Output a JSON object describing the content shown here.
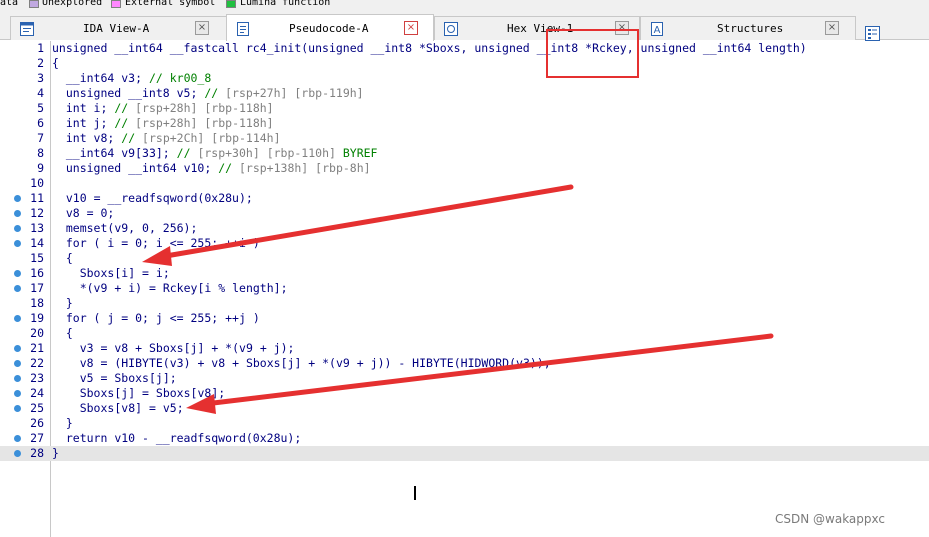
{
  "legend": [
    {
      "label": "ata",
      "swatch": "#c8b878"
    },
    {
      "label": "Unexplored",
      "swatch": "#c0a8e0"
    },
    {
      "label": "External symbol",
      "swatch": "#ff88ff"
    },
    {
      "label": "Lumina function",
      "swatch": "#20c040"
    }
  ],
  "tabs": [
    {
      "label": "IDA View-A",
      "icon": "ida-view-icon",
      "active": false
    },
    {
      "label": "Pseudocode-A",
      "icon": "pseudocode-icon",
      "active": true
    },
    {
      "label": "Hex View-1",
      "icon": "hex-view-icon",
      "active": false
    },
    {
      "label": "Structures",
      "icon": "structures-icon",
      "active": false
    }
  ],
  "close_glyph": "×",
  "code": [
    {
      "n": "1",
      "dot": false,
      "t": "unsigned __int64 __fastcall rc4_init(unsigned __int8 *Sboxs, unsigned __int8 *Rckey, unsigned __int64 length)"
    },
    {
      "n": "2",
      "dot": false,
      "t": "{"
    },
    {
      "n": "3",
      "dot": false,
      "t": "  __int64 v3; // kr00_8"
    },
    {
      "n": "4",
      "dot": false,
      "t": "  unsigned __int8 v5; // [rsp+27h] [rbp-119h]"
    },
    {
      "n": "5",
      "dot": false,
      "t": "  int i; // [rsp+28h] [rbp-118h]"
    },
    {
      "n": "6",
      "dot": false,
      "t": "  int j; // [rsp+28h] [rbp-118h]"
    },
    {
      "n": "7",
      "dot": false,
      "t": "  int v8; // [rsp+2Ch] [rbp-114h]"
    },
    {
      "n": "8",
      "dot": false,
      "t": "  __int64 v9[33]; // [rsp+30h] [rbp-110h] BYREF"
    },
    {
      "n": "9",
      "dot": false,
      "t": "  unsigned __int64 v10; // [rsp+138h] [rbp-8h]"
    },
    {
      "n": "10",
      "dot": false,
      "t": ""
    },
    {
      "n": "11",
      "dot": true,
      "t": "  v10 = __readfsqword(0x28u);"
    },
    {
      "n": "12",
      "dot": true,
      "t": "  v8 = 0;"
    },
    {
      "n": "13",
      "dot": true,
      "t": "  memset(v9, 0, 256);"
    },
    {
      "n": "14",
      "dot": true,
      "t": "  for ( i = 0; i <= 255; ++i )"
    },
    {
      "n": "15",
      "dot": false,
      "t": "  {"
    },
    {
      "n": "16",
      "dot": true,
      "t": "    Sboxs[i] = i;"
    },
    {
      "n": "17",
      "dot": true,
      "t": "    *(v9 + i) = Rckey[i % length];"
    },
    {
      "n": "18",
      "dot": false,
      "t": "  }"
    },
    {
      "n": "19",
      "dot": true,
      "t": "  for ( j = 0; j <= 255; ++j )"
    },
    {
      "n": "20",
      "dot": false,
      "t": "  {"
    },
    {
      "n": "21",
      "dot": true,
      "t": "    v3 = v8 + Sboxs[j] + *(v9 + j);"
    },
    {
      "n": "22",
      "dot": true,
      "t": "    v8 = (HIBYTE(v3) + v8 + Sboxs[j] + *(v9 + j)) - HIBYTE(HIDWORD(v3));"
    },
    {
      "n": "23",
      "dot": true,
      "t": "    v5 = Sboxs[j];"
    },
    {
      "n": "24",
      "dot": true,
      "t": "    Sboxs[j] = Sboxs[v8];"
    },
    {
      "n": "25",
      "dot": true,
      "t": "    Sboxs[v8] = v5;"
    },
    {
      "n": "26",
      "dot": false,
      "t": "  }"
    },
    {
      "n": "27",
      "dot": true,
      "t": "  return v10 - __readfsqword(0x28u);"
    },
    {
      "n": "28",
      "dot": true,
      "t": "}"
    }
  ],
  "current_line": "28",
  "annotation_color": "#e53030",
  "watermark": "CSDN @wakappxc"
}
